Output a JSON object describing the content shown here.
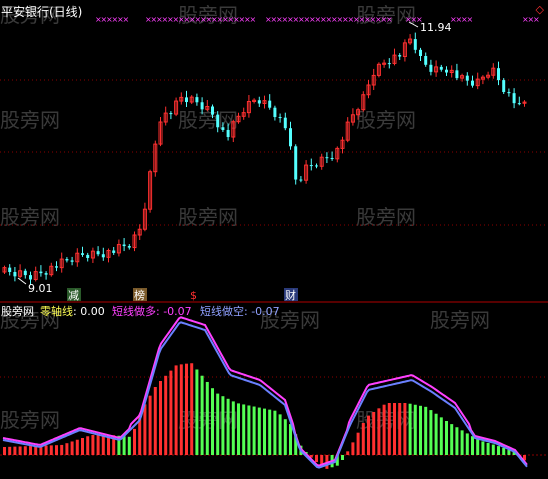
{
  "window_title": "平安银行(日线)",
  "top_right_marker": "◇",
  "price_high_label": "11.94",
  "price_low_label": "9.01",
  "event_markers": [
    "减",
    "榜",
    "$",
    "财"
  ],
  "watermark": "股旁网",
  "indicator_name": "零轴线",
  "indicator_value": ": 0.00",
  "bull_line_name": "短线做多",
  "bull_line_value": ": -0.07",
  "bear_line_name": "短线做空",
  "bear_line_value": ": -0.07",
  "colors": {
    "up_candle": "#ff3030",
    "down_candle": "#54ffff",
    "bull_bar": "#ff3030",
    "bear_bar": "#54ff54",
    "bull_line": "#ff40ff",
    "bear_line": "#6a80ff",
    "zero_label": "#ffff54",
    "grid": "#8b0000",
    "x_marker": "#ff40ff"
  }
}
